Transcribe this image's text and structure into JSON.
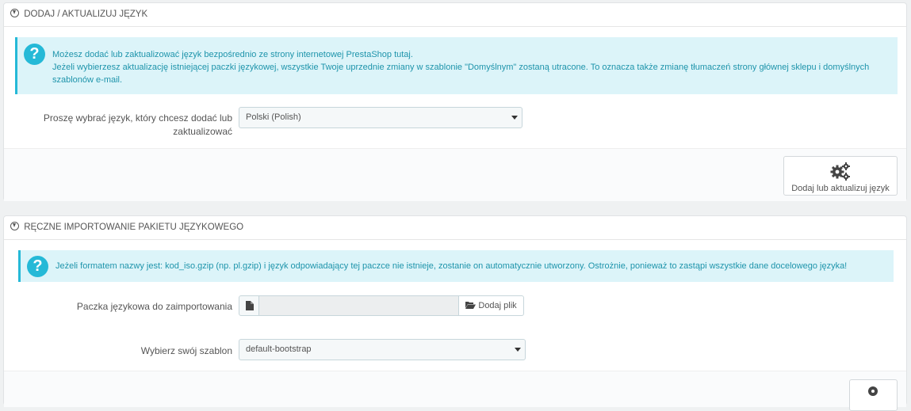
{
  "panel1": {
    "heading": "DODAJ / AKTUALIZUJ JĘZYK",
    "alert_line1": "Możesz dodać lub zaktualizować język bezpośrednio ze strony internetowej PrestaShop tutaj.",
    "alert_line2": "Jeżeli wybierzesz aktualizację istniejącej paczki językowej, wszystkie Twoje uprzednie zmiany w szablonie \"Domyślnym\" zostaną utracone. To oznacza także zmianę tłumaczeń strony głównej sklepu i domyślnych szablonów e-mail.",
    "language_label": "Proszę wybrać język, który chcesz dodać lub zaktualizować",
    "language_value": "Polski (Polish)",
    "submit_label": "Dodaj lub aktualizuj język"
  },
  "panel2": {
    "heading": "RĘCZNE IMPORTOWANIE PAKIETU JĘZYKOWEGO",
    "alert_text": "Jeżeli formatem nazwy jest: kod_iso.gzip (np. pl.gzip) i język odpowiadający tej paczce nie istnieje, zostanie on automatycznie utworzony. Ostrożnie, ponieważ to zastąpi wszystkie dane docelowego języka!",
    "file_label": "Paczka językowa do zaimportowania",
    "file_button": "Dodaj plik",
    "theme_label": "Wybierz swój szablon",
    "theme_value": "default-bootstrap"
  },
  "colors": {
    "info_bg": "#dcf4f9",
    "info_accent": "#25b9d7",
    "info_text": "#1e94ab"
  },
  "icons": [
    "download-circle-icon",
    "question-icon",
    "gears-icon",
    "file-icon",
    "folder-open-icon"
  ]
}
